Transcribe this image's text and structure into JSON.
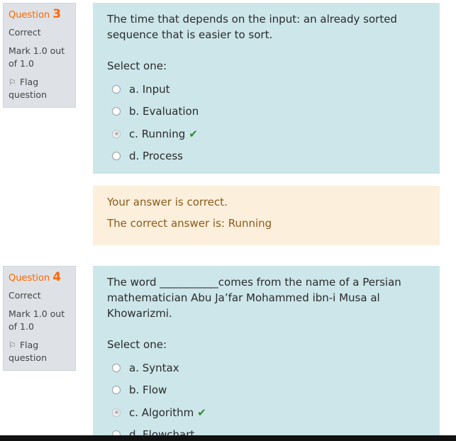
{
  "questions": [
    {
      "label": "Question",
      "number": "3",
      "state": "Correct",
      "grade": "Mark 1.0 out of 1.0",
      "flag": "Flag question",
      "text": "The time that depends on the input: an already sorted sequence that is easier to sort.",
      "prompt": "Select one:",
      "options": [
        {
          "label": "a. Input",
          "checked": false,
          "correct": false
        },
        {
          "label": "b. Evaluation",
          "checked": false,
          "correct": false
        },
        {
          "label": "c. Running",
          "checked": true,
          "correct": true
        },
        {
          "label": "d.  Process",
          "checked": false,
          "correct": false
        }
      ],
      "feedback": {
        "outcome": "Your answer is correct.",
        "right_answer": "The correct answer is: Running"
      }
    },
    {
      "label": "Question",
      "number": "4",
      "state": "Correct",
      "grade": "Mark 1.0 out of 1.0",
      "flag": "Flag question",
      "text": "The word ___________comes from the name of a Persian mathematician Abu Ja’far Mohammed ibn-i Musa al Khowarizmi.",
      "prompt": "Select one:",
      "options": [
        {
          "label": "a. Syntax",
          "checked": false,
          "correct": false
        },
        {
          "label": "b.  Flow",
          "checked": false,
          "correct": false
        },
        {
          "label": "c. Algorithm",
          "checked": true,
          "correct": true
        },
        {
          "label": "d. Flowchart",
          "checked": false,
          "correct": false
        }
      ]
    }
  ],
  "icons": {
    "flag": "flag-icon",
    "check": "check-icon"
  },
  "colors": {
    "question_number": "#ff6600",
    "formulation_bg": "#cce6ea",
    "feedback_bg": "#fcefdc",
    "info_bg": "#dee2e6",
    "check": "#2e8b2e"
  }
}
